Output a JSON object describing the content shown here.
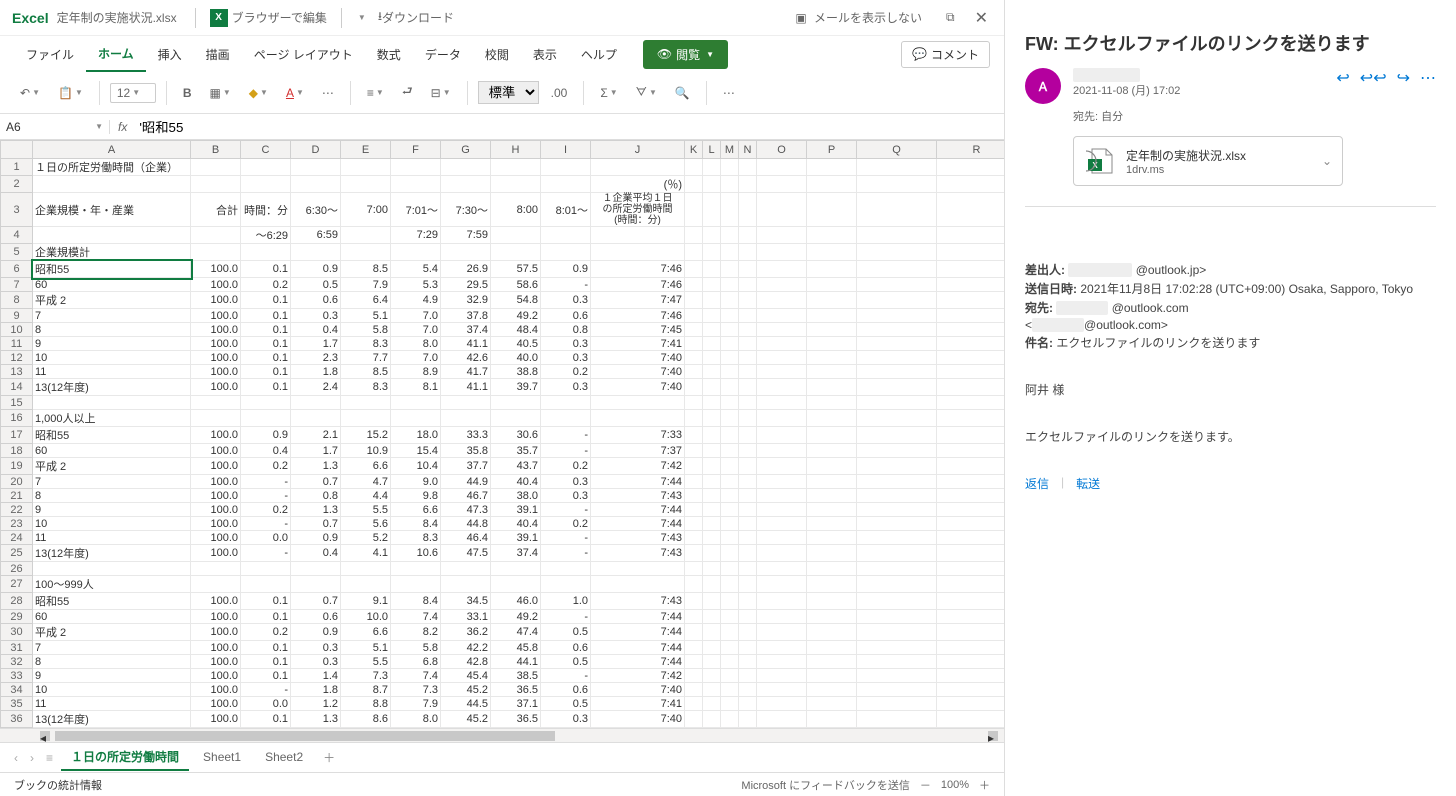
{
  "titlebar": {
    "app": "Excel",
    "filename": "定年制の実施状況.xlsx",
    "edit_label": "ブラウザーで編集",
    "download_label": "ダウンロード",
    "hide_mail": "メールを表示しない"
  },
  "tabs": {
    "file": "ファイル",
    "home": "ホーム",
    "insert": "挿入",
    "draw": "描画",
    "layout": "ページ レイアウト",
    "formulas": "数式",
    "data": "データ",
    "review": "校閲",
    "view": "表示",
    "help": "ヘルプ",
    "viewing": "閲覧",
    "comments": "コメント"
  },
  "toolbar": {
    "font_size": "12",
    "number_format": "標準"
  },
  "namebox": "A6",
  "formula": "'昭和55",
  "columns": [
    "A",
    "B",
    "C",
    "D",
    "E",
    "F",
    "G",
    "H",
    "I",
    "J",
    "K",
    "L",
    "M",
    "N",
    "O",
    "P",
    "Q",
    "R"
  ],
  "headers": {
    "r1_a": "１日の所定労働時間（企業）",
    "r2_pct": "(％)",
    "r3_a": "企業規模・年・産業",
    "r3_b": "合計",
    "r3_c": "時間：分",
    "r3_d": "6:30～",
    "r3_e": "7:00",
    "r3_f": "7:01～",
    "r3_g": "7:30～",
    "r3_h": "8:00",
    "r3_i": "8:01～",
    "r3_j1": "１企業平均１日",
    "r3_j2": "の所定労働時間",
    "r3_j3": "(時間：分)",
    "r4_c": "～6:29",
    "r4_d": "6:59",
    "r4_f": "7:29",
    "r4_g": "7:59",
    "r5_a": "企業規模計"
  },
  "chart_data": {
    "type": "table",
    "title": "１日の所定労働時間（企業）",
    "sections": [
      {
        "name": "企業規模計",
        "rows": [
          {
            "label": "昭和55",
            "total": "100.0",
            "c": "0.1",
            "d": "0.9",
            "e": "8.5",
            "f": "5.4",
            "g": "26.9",
            "h": "57.5",
            "i": "0.9",
            "avg": "7:46"
          },
          {
            "label": "60",
            "total": "100.0",
            "c": "0.2",
            "d": "0.5",
            "e": "7.9",
            "f": "5.3",
            "g": "29.5",
            "h": "58.6",
            "i": "-",
            "avg": "7:46"
          },
          {
            "label": "平成 2",
            "total": "100.0",
            "c": "0.1",
            "d": "0.6",
            "e": "6.4",
            "f": "4.9",
            "g": "32.9",
            "h": "54.8",
            "i": "0.3",
            "avg": "7:47"
          },
          {
            "label": "7",
            "total": "100.0",
            "c": "0.1",
            "d": "0.3",
            "e": "5.1",
            "f": "7.0",
            "g": "37.8",
            "h": "49.2",
            "i": "0.6",
            "avg": "7:46"
          },
          {
            "label": "8",
            "total": "100.0",
            "c": "0.1",
            "d": "0.4",
            "e": "5.8",
            "f": "7.0",
            "g": "37.4",
            "h": "48.4",
            "i": "0.8",
            "avg": "7:45"
          },
          {
            "label": "9",
            "total": "100.0",
            "c": "0.1",
            "d": "1.7",
            "e": "8.3",
            "f": "8.0",
            "g": "41.1",
            "h": "40.5",
            "i": "0.3",
            "avg": "7:41"
          },
          {
            "label": "10",
            "total": "100.0",
            "c": "0.1",
            "d": "2.3",
            "e": "7.7",
            "f": "7.0",
            "g": "42.6",
            "h": "40.0",
            "i": "0.3",
            "avg": "7:40"
          },
          {
            "label": "11",
            "total": "100.0",
            "c": "0.1",
            "d": "1.8",
            "e": "8.5",
            "f": "8.9",
            "g": "41.7",
            "h": "38.8",
            "i": "0.2",
            "avg": "7:40"
          },
          {
            "label": "13(12年度)",
            "total": "100.0",
            "c": "0.1",
            "d": "2.4",
            "e": "8.3",
            "f": "8.1",
            "g": "41.1",
            "h": "39.7",
            "i": "0.3",
            "avg": "7:40"
          }
        ]
      },
      {
        "name": "1,000人以上",
        "rows": [
          {
            "label": "昭和55",
            "total": "100.0",
            "c": "0.9",
            "d": "2.1",
            "e": "15.2",
            "f": "18.0",
            "g": "33.3",
            "h": "30.6",
            "i": "-",
            "avg": "7:33"
          },
          {
            "label": "60",
            "total": "100.0",
            "c": "0.4",
            "d": "1.7",
            "e": "10.9",
            "f": "15.4",
            "g": "35.8",
            "h": "35.7",
            "i": "-",
            "avg": "7:37"
          },
          {
            "label": "平成 2",
            "total": "100.0",
            "c": "0.2",
            "d": "1.3",
            "e": "6.6",
            "f": "10.4",
            "g": "37.7",
            "h": "43.7",
            "i": "0.2",
            "avg": "7:42"
          },
          {
            "label": "7",
            "total": "100.0",
            "c": "-",
            "d": "0.7",
            "e": "4.7",
            "f": "9.0",
            "g": "44.9",
            "h": "40.4",
            "i": "0.3",
            "avg": "7:44"
          },
          {
            "label": "8",
            "total": "100.0",
            "c": "-",
            "d": "0.8",
            "e": "4.4",
            "f": "9.8",
            "g": "46.7",
            "h": "38.0",
            "i": "0.3",
            "avg": "7:43"
          },
          {
            "label": "9",
            "total": "100.0",
            "c": "0.2",
            "d": "1.3",
            "e": "5.5",
            "f": "6.6",
            "g": "47.3",
            "h": "39.1",
            "i": "-",
            "avg": "7:44"
          },
          {
            "label": "10",
            "total": "100.0",
            "c": "-",
            "d": "0.7",
            "e": "5.6",
            "f": "8.4",
            "g": "44.8",
            "h": "40.4",
            "i": "0.2",
            "avg": "7:44"
          },
          {
            "label": "11",
            "total": "100.0",
            "c": "0.0",
            "d": "0.9",
            "e": "5.2",
            "f": "8.3",
            "g": "46.4",
            "h": "39.1",
            "i": "-",
            "avg": "7:43"
          },
          {
            "label": "13(12年度)",
            "total": "100.0",
            "c": "-",
            "d": "0.4",
            "e": "4.1",
            "f": "10.6",
            "g": "47.5",
            "h": "37.4",
            "i": "-",
            "avg": "7:43"
          }
        ]
      },
      {
        "name": "100～999人",
        "rows": [
          {
            "label": "昭和55",
            "total": "100.0",
            "c": "0.1",
            "d": "0.7",
            "e": "9.1",
            "f": "8.4",
            "g": "34.5",
            "h": "46.0",
            "i": "1.0",
            "avg": "7:43"
          },
          {
            "label": "60",
            "total": "100.0",
            "c": "0.1",
            "d": "0.6",
            "e": "10.0",
            "f": "7.4",
            "g": "33.1",
            "h": "49.2",
            "i": "-",
            "avg": "7:44"
          },
          {
            "label": "平成 2",
            "total": "100.0",
            "c": "0.2",
            "d": "0.9",
            "e": "6.6",
            "f": "8.2",
            "g": "36.2",
            "h": "47.4",
            "i": "0.5",
            "avg": "7:44"
          },
          {
            "label": "7",
            "total": "100.0",
            "c": "0.1",
            "d": "0.3",
            "e": "5.1",
            "f": "5.8",
            "g": "42.2",
            "h": "45.8",
            "i": "0.6",
            "avg": "7:44"
          },
          {
            "label": "8",
            "total": "100.0",
            "c": "0.1",
            "d": "0.3",
            "e": "5.5",
            "f": "6.8",
            "g": "42.8",
            "h": "44.1",
            "i": "0.5",
            "avg": "7:44"
          },
          {
            "label": "9",
            "total": "100.0",
            "c": "0.1",
            "d": "1.4",
            "e": "7.3",
            "f": "7.4",
            "g": "45.4",
            "h": "38.5",
            "i": "-",
            "avg": "7:42"
          },
          {
            "label": "10",
            "total": "100.0",
            "c": "-",
            "d": "1.8",
            "e": "8.7",
            "f": "7.3",
            "g": "45.2",
            "h": "36.5",
            "i": "0.6",
            "avg": "7:40"
          },
          {
            "label": "11",
            "total": "100.0",
            "c": "0.0",
            "d": "1.2",
            "e": "8.8",
            "f": "7.9",
            "g": "44.5",
            "h": "37.1",
            "i": "0.5",
            "avg": "7:41"
          },
          {
            "label": "13(12年度)",
            "total": "100.0",
            "c": "0.1",
            "d": "1.3",
            "e": "8.6",
            "f": "8.0",
            "g": "45.2",
            "h": "36.5",
            "i": "0.3",
            "avg": "7:40"
          }
        ]
      }
    ]
  },
  "sheets": {
    "s1": "１日の所定労働時間",
    "s2": "Sheet1",
    "s3": "Sheet2"
  },
  "status": {
    "stats": "ブックの統計情報",
    "feedback": "Microsoft にフィードバックを送信",
    "zoom": "100%"
  },
  "email": {
    "subject": "FW: エクセルファイルのリンクを送ります",
    "timestamp": "2021-11-08 (月) 17:02",
    "to": "宛先: 自分",
    "attachment_name": "定年制の実施状況.xlsx",
    "attachment_src": "1drv.ms",
    "from_label": "差出人:",
    "from_email": "@outlook.jp>",
    "sent_label": "送信日時:",
    "sent_value": "2021年11月8日 17:02:28 (UTC+09:00) Osaka, Sapporo, Tokyo",
    "to_label": "宛先:",
    "to_value": "@outlook.com",
    "to_value2": "@outlook.com>",
    "subj_label": "件名:",
    "subj_value": "エクセルファイルのリンクを送ります",
    "greeting": "阿井 様",
    "body": "エクセルファイルのリンクを送ります。",
    "reply": "返信",
    "forward": "転送"
  }
}
